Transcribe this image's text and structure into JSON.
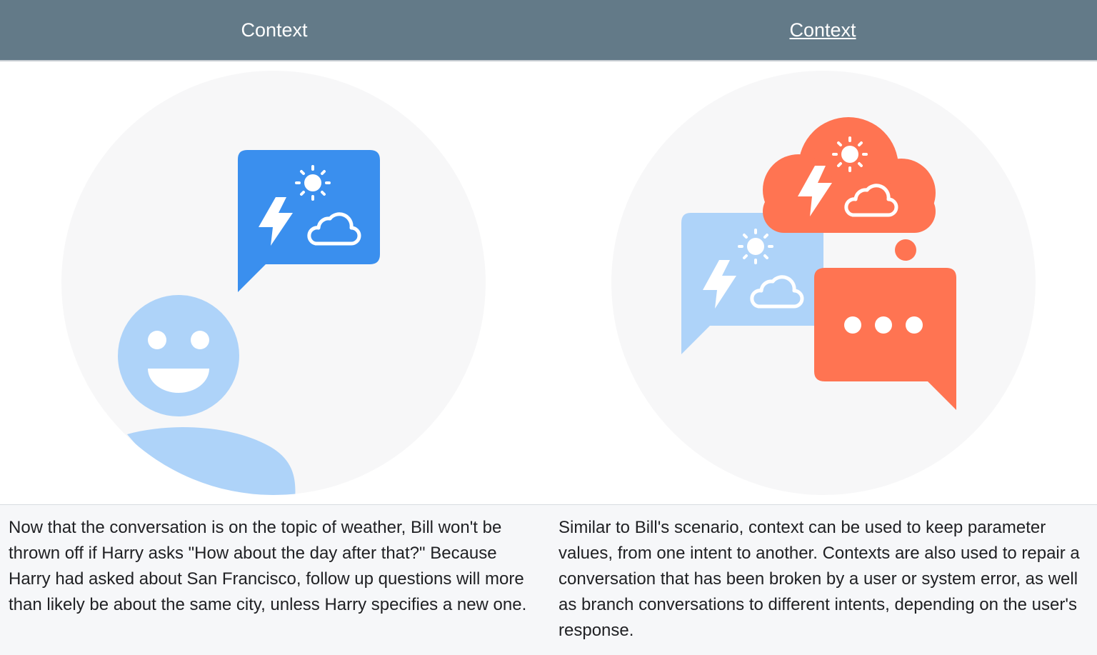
{
  "columns": [
    {
      "heading": "Context",
      "heading_is_link": false,
      "description": "Now that the conversation is on the topic of weather, Bill won't be thrown off if Harry asks \"How about the day after that?\" Because Harry had asked about San Francisco, follow up questions will more than likely be about the same city, unless Harry specifies a new one."
    },
    {
      "heading": "Context",
      "heading_is_link": true,
      "description": "Similar to Bill's scenario, context can be used to keep parameter values, from one intent to another. Contexts are also used to repair a conversation that has been broken by a user or system error, as well as branch conversations to different intents, depending on the user's response."
    }
  ],
  "colors": {
    "header_bg": "#637a88",
    "circle_bg": "#f7f7f8",
    "bubble_blue": "#3a8fee",
    "light_blue": "#aed3f9",
    "coral": "#ff7452",
    "text_row_bg": "#f6f7f9"
  },
  "icons": [
    "smiley-user-icon",
    "weather-speech-bubble-icon",
    "weather-cloud-bubble-icon",
    "typing-speech-bubble-icon",
    "sun-icon",
    "lightning-icon",
    "cloud-icon"
  ]
}
